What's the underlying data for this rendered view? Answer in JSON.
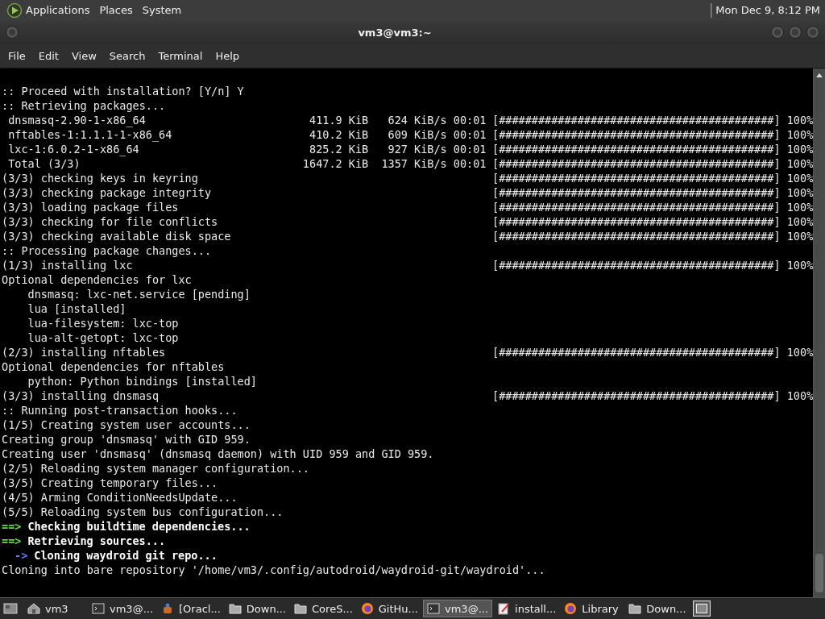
{
  "top_panel": {
    "menus": [
      "Applications",
      "Places",
      "System"
    ],
    "clock": "Mon Dec 9, 8:12 PM"
  },
  "window": {
    "title": "vm3@vm3:~"
  },
  "menu_bar": [
    "File",
    "Edit",
    "View",
    "Search",
    "Terminal",
    "Help"
  ],
  "terminal": {
    "lines": [
      {
        "kind": "plain",
        "text": ":: Proceed with installation? [Y/n] Y"
      },
      {
        "kind": "plain",
        "text": ":: Retrieving packages..."
      },
      {
        "kind": "plain",
        "text": " dnsmasq-2.90-1-x86_64                         411.9 KiB   624 KiB/s 00:01",
        "progress": "[##########################################] 100%"
      },
      {
        "kind": "plain",
        "text": " nftables-1:1.1.1-1-x86_64                     410.2 KiB   609 KiB/s 00:01",
        "progress": "[##########################################] 100%"
      },
      {
        "kind": "plain",
        "text": " lxc-1:6.0.2-1-x86_64                          825.2 KiB   927 KiB/s 00:01",
        "progress": "[##########################################] 100%"
      },
      {
        "kind": "plain",
        "text": " Total (3/3)                                  1647.2 KiB  1357 KiB/s 00:01",
        "progress": "[##########################################] 100%"
      },
      {
        "kind": "plain",
        "text": "(3/3) checking keys in keyring",
        "progress": "[##########################################] 100%"
      },
      {
        "kind": "plain",
        "text": "(3/3) checking package integrity",
        "progress": "[##########################################] 100%"
      },
      {
        "kind": "plain",
        "text": "(3/3) loading package files",
        "progress": "[##########################################] 100%"
      },
      {
        "kind": "plain",
        "text": "(3/3) checking for file conflicts",
        "progress": "[##########################################] 100%"
      },
      {
        "kind": "plain",
        "text": "(3/3) checking available disk space",
        "progress": "[##########################################] 100%"
      },
      {
        "kind": "plain",
        "text": ":: Processing package changes..."
      },
      {
        "kind": "plain",
        "text": "(1/3) installing lxc",
        "progress": "[##########################################] 100%"
      },
      {
        "kind": "plain",
        "text": "Optional dependencies for lxc"
      },
      {
        "kind": "plain",
        "text": "    dnsmasq: lxc-net.service [pending]"
      },
      {
        "kind": "plain",
        "text": "    lua [installed]"
      },
      {
        "kind": "plain",
        "text": "    lua-filesystem: lxc-top"
      },
      {
        "kind": "plain",
        "text": "    lua-alt-getopt: lxc-top"
      },
      {
        "kind": "plain",
        "text": "(2/3) installing nftables",
        "progress": "[##########################################] 100%"
      },
      {
        "kind": "plain",
        "text": "Optional dependencies for nftables"
      },
      {
        "kind": "plain",
        "text": "    python: Python bindings [installed]"
      },
      {
        "kind": "plain",
        "text": "(3/3) installing dnsmasq",
        "progress": "[##########################################] 100%"
      },
      {
        "kind": "plain",
        "text": ":: Running post-transaction hooks..."
      },
      {
        "kind": "plain",
        "text": "(1/5) Creating system user accounts..."
      },
      {
        "kind": "plain",
        "text": "Creating group 'dnsmasq' with GID 959."
      },
      {
        "kind": "plain",
        "text": "Creating user 'dnsmasq' (dnsmasq daemon) with UID 959 and GID 959."
      },
      {
        "kind": "plain",
        "text": "(2/5) Reloading system manager configuration..."
      },
      {
        "kind": "plain",
        "text": "(3/5) Creating temporary files..."
      },
      {
        "kind": "plain",
        "text": "(4/5) Arming ConditionNeedsUpdate..."
      },
      {
        "kind": "plain",
        "text": "(5/5) Reloading system bus configuration..."
      },
      {
        "kind": "step",
        "marker": "==>",
        "text": "Checking buildtime dependencies..."
      },
      {
        "kind": "step",
        "marker": "==>",
        "text": "Retrieving sources..."
      },
      {
        "kind": "substep",
        "marker": "->",
        "text": "Cloning waydroid git repo..."
      },
      {
        "kind": "plain",
        "text": "Cloning into bare repository '/home/vm3/.config/autodroid/waydroid-git/waydroid'..."
      }
    ]
  },
  "taskbar": {
    "items": [
      {
        "kind": "home",
        "label": "vm3",
        "selected": false
      },
      {
        "kind": "terminal",
        "label": "vm3@...",
        "selected": false
      },
      {
        "kind": "app",
        "label": "[Oracl...",
        "selected": false
      },
      {
        "kind": "folder",
        "label": "Down...",
        "selected": false
      },
      {
        "kind": "folder",
        "label": "CoreS...",
        "selected": false
      },
      {
        "kind": "browser",
        "label": "GitHu...",
        "selected": false
      },
      {
        "kind": "terminal",
        "label": "vm3@...",
        "selected": true
      },
      {
        "kind": "editor",
        "label": "install...",
        "selected": false
      },
      {
        "kind": "browser",
        "label": "Library",
        "selected": false
      },
      {
        "kind": "folder",
        "label": "Down...",
        "selected": false
      }
    ]
  }
}
